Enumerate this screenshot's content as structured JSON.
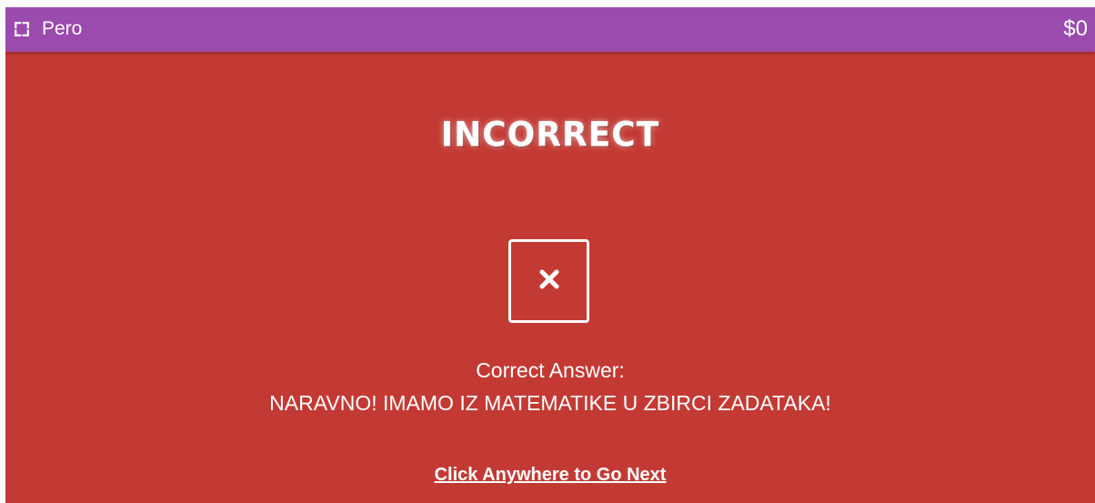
{
  "topbar": {
    "fullscreen_icon": "fullscreen-icon",
    "player_name": "Pero",
    "cash": "$0",
    "color": "#9b4aad"
  },
  "result": {
    "title": "INCORRECT",
    "icon": "close-icon",
    "background_color": "#c33a34"
  },
  "answer": {
    "label": "Correct Answer:",
    "text": "NARAVNO! IMAMO IZ MATEMATIKE U ZBIRCI ZADATAKA!"
  },
  "next": {
    "label": "Click Anywhere to Go Next"
  }
}
